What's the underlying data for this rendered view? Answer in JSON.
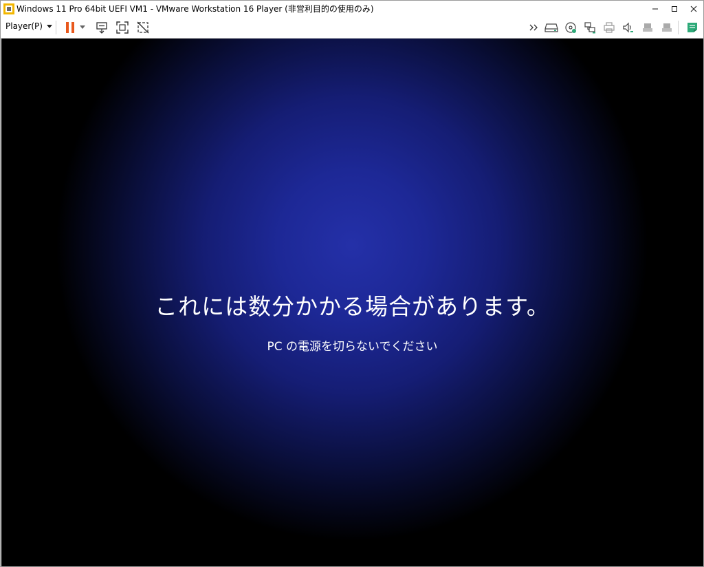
{
  "window": {
    "title": "Windows 11 Pro 64bit UEFI VM1 - VMware Workstation 16 Player (非営利目的の使用のみ)",
    "minimize_glyph": "—",
    "maximize_glyph": "□",
    "close_glyph": "✕"
  },
  "toolbar": {
    "player_menu_label": "Player(P)",
    "left_icons": [
      "pause-icon",
      "pause-dropdown-icon",
      "send-ctrl-alt-del-icon",
      "full-screen-icon",
      "unity-icon"
    ],
    "right_icons": [
      "show-more-icon",
      "hard-disk-icon",
      "cd-dvd-icon",
      "network-adapter-icon",
      "printer-icon",
      "sound-card-icon",
      "usb-device-1-icon",
      "usb-device-2-icon",
      "message-log-icon"
    ]
  },
  "guest_screen": {
    "main_message": "これには数分かかる場合があります。",
    "sub_message": "PC の電源を切らないでください"
  },
  "colors": {
    "pause_orange": "#e8581c",
    "message_log_green": "#2eaa79",
    "screen_center_blue": "#2430a8",
    "screen_edge": "#000000"
  }
}
